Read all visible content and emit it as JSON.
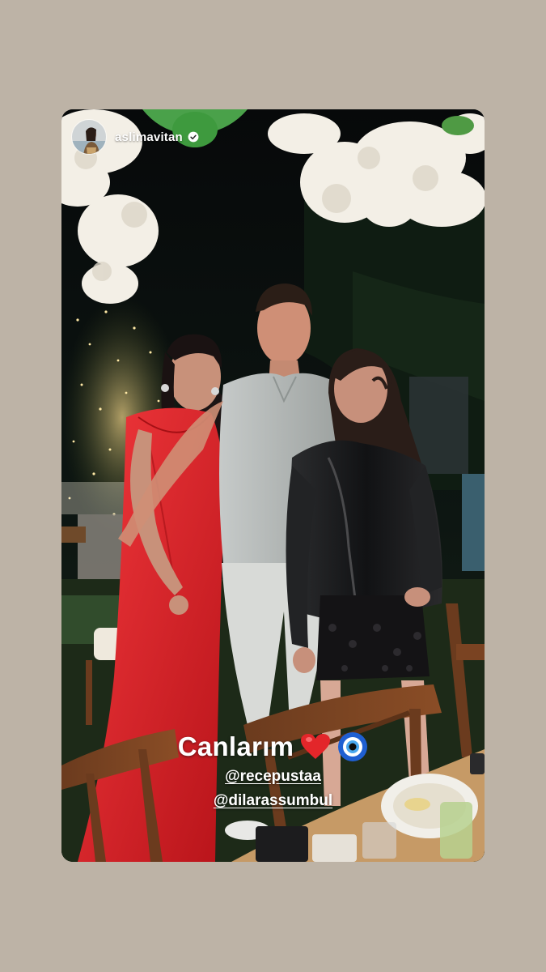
{
  "story": {
    "username": "aslimavitan",
    "verified": true,
    "caption": {
      "text": "Canlarım",
      "emojis": [
        "heart-icon",
        "nazar-evil-eye-icon"
      ]
    },
    "mentions": [
      "@recepustaa",
      "@dilarassumbul"
    ]
  },
  "colors": {
    "background": "#bdb3a6",
    "heart": "#e3262a",
    "nazar_blue": "#1f5fd1",
    "red_dress": "#e2252b",
    "leather_jacket": "#1c1c1e"
  }
}
